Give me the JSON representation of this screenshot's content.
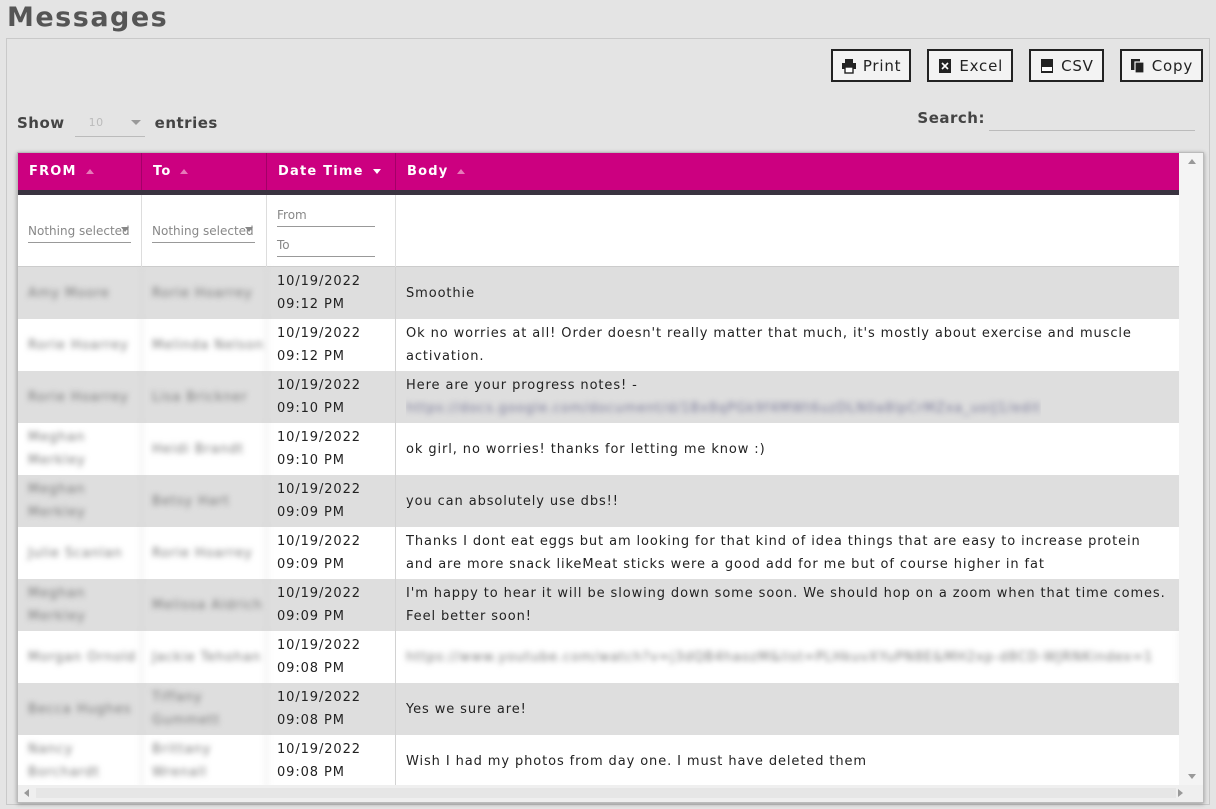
{
  "page": {
    "title": "Messages"
  },
  "toolbar": {
    "print_label": "Print",
    "excel_label": "Excel",
    "csv_label": "CSV",
    "copy_label": "Copy"
  },
  "length": {
    "show_label": "Show",
    "value": "10",
    "entries_label": "entries"
  },
  "search": {
    "label": "Search:",
    "value": ""
  },
  "table": {
    "headers": {
      "from": "FROM",
      "to": "To",
      "datetime": "Date Time",
      "body": "Body"
    },
    "filters": {
      "from_placeholder": "Nothing selected",
      "to_placeholder": "Nothing selected",
      "date_from": "From",
      "date_to": "To"
    },
    "rows": [
      {
        "from": "Amy Moore",
        "to": "Rorie Hoarrey",
        "date": "10/19/2022",
        "time": "09:12 PM",
        "body": "Smoothie",
        "body_redacted": false
      },
      {
        "from": "Rorie Hoarrey",
        "to": "Melinda Nelson",
        "date": "10/19/2022",
        "time": "09:12 PM",
        "body": "Ok no worries at all! Order doesn't really matter that much, it's mostly about exercise and muscle activation.",
        "body_redacted": false
      },
      {
        "from": "Rorie Hoarrey",
        "to": "Lisa Brickner",
        "date": "10/19/2022",
        "time": "09:10 PM",
        "body": "Here are your progress notes! -",
        "body_link": "https://docs.google.com/document/d/1Bx8qPGk9f4MWt6uzDLN0a8lpCrMZxa_uoiJ1/edit",
        "body_redacted": false
      },
      {
        "from": "Meghan Merkley",
        "to": "Heidi Brandt",
        "date": "10/19/2022",
        "time": "09:10 PM",
        "body": "ok girl, no worries! thanks for letting me know :)",
        "body_redacted": false
      },
      {
        "from": "Meghan Merkley",
        "to": "Betsy Hart",
        "date": "10/19/2022",
        "time": "09:09 PM",
        "body": "you can absolutely use dbs!!",
        "body_redacted": false
      },
      {
        "from": "Julie Scanlan",
        "to": "Rorie Hoarrey",
        "date": "10/19/2022",
        "time": "09:09 PM",
        "body": "Thanks I dont eat eggs but am looking for that kind of idea things that are easy to increase protein and are more snack likeMeat sticks were a good add for me but of course higher in fat",
        "body_redacted": false
      },
      {
        "from": "Meghan Merkley",
        "to": "Melissa Aldrich",
        "date": "10/19/2022",
        "time": "09:09 PM",
        "body": "I'm happy to hear it will be slowing down some soon. We should hop on a zoom when that time comes. Feel better soon!",
        "body_redacted": false
      },
      {
        "from": "Morgan Ornold",
        "to": "Jackie Tehohan",
        "date": "10/19/2022",
        "time": "09:08 PM",
        "body": "https://www.youtube.com/watch?v=j3dQB4haozM&list=PLHkuvXYuPN8E&MH2xp-d8CD-WJRNKindex=1",
        "body_redacted": true
      },
      {
        "from": "Becca Hughes",
        "to": "Tiffany Gummett",
        "date": "10/19/2022",
        "time": "09:08 PM",
        "body": "Yes we sure are!",
        "body_redacted": false
      },
      {
        "from": "Nancy Borchardt",
        "to": "Brittany Wrenall",
        "date": "10/19/2022",
        "time": "09:08 PM",
        "body": "Wish I had my photos from day one. I must have deleted them",
        "body_redacted": false
      }
    ]
  }
}
